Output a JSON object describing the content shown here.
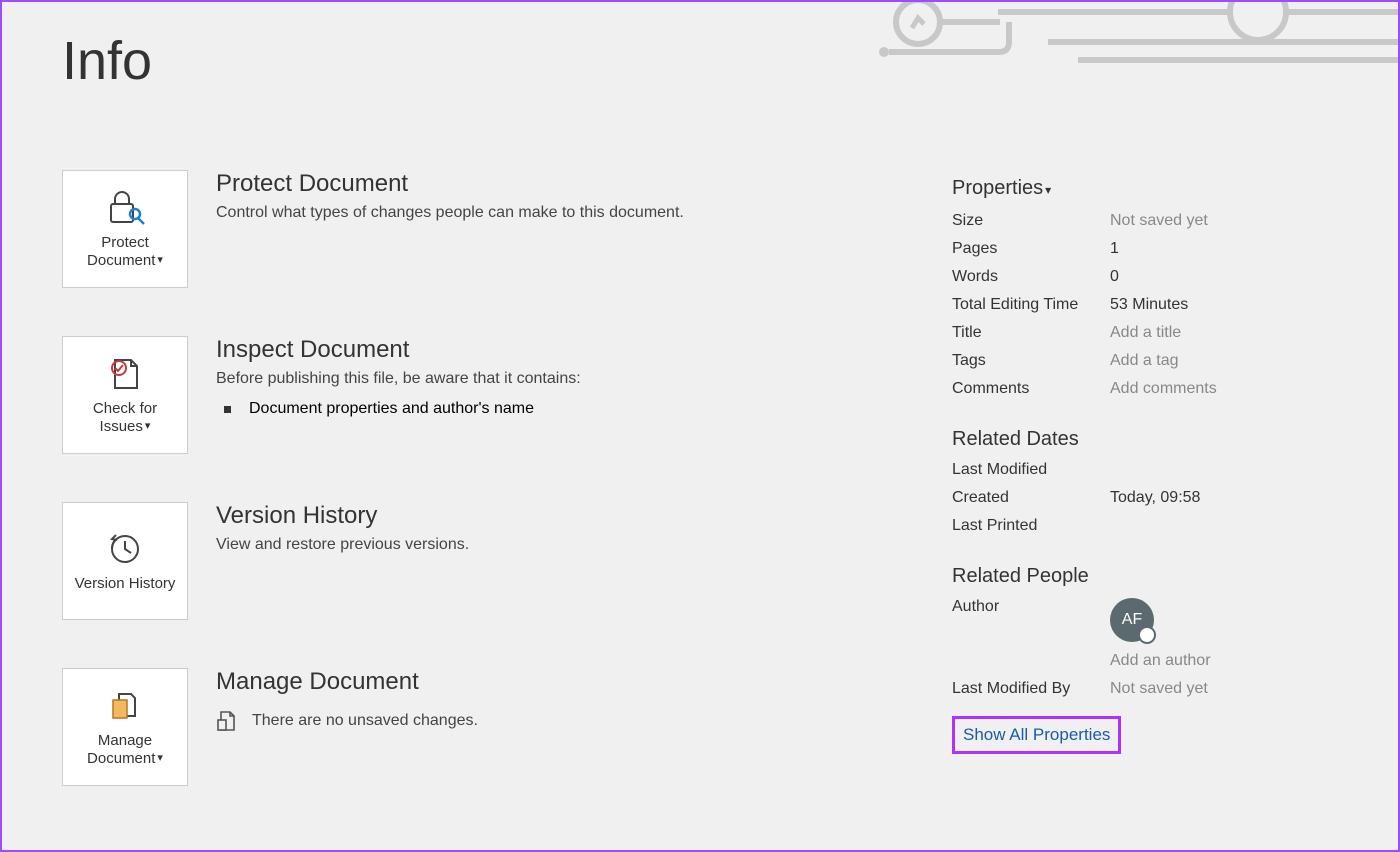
{
  "page_title": "Info",
  "sections": {
    "protect": {
      "tile_label": "Protect Document",
      "heading": "Protect Document",
      "desc": "Control what types of changes people can make to this document."
    },
    "inspect": {
      "tile_label": "Check for Issues",
      "heading": "Inspect Document",
      "desc": "Before publishing this file, be aware that it contains:",
      "bullet1": "Document properties and author's name"
    },
    "version": {
      "tile_label": "Version History",
      "heading": "Version History",
      "desc": "View and restore previous versions."
    },
    "manage": {
      "tile_label": "Manage Document",
      "heading": "Manage Document",
      "desc": "There are no unsaved changes."
    }
  },
  "properties": {
    "header": "Properties",
    "rows": {
      "size_label": "Size",
      "size_value": "Not saved yet",
      "pages_label": "Pages",
      "pages_value": "1",
      "words_label": "Words",
      "words_value": "0",
      "editing_label": "Total Editing Time",
      "editing_value": "53 Minutes",
      "title_label": "Title",
      "title_value": "Add a title",
      "tags_label": "Tags",
      "tags_value": "Add a tag",
      "comments_label": "Comments",
      "comments_value": "Add comments"
    }
  },
  "related_dates": {
    "header": "Related Dates",
    "last_modified_label": "Last Modified",
    "last_modified_value": "",
    "created_label": "Created",
    "created_value": "Today, 09:58",
    "last_printed_label": "Last Printed",
    "last_printed_value": ""
  },
  "related_people": {
    "header": "Related People",
    "author_label": "Author",
    "author_initials": "AF",
    "add_author": "Add an author",
    "last_modified_by_label": "Last Modified By",
    "last_modified_by_value": "Not saved yet"
  },
  "show_all_label": "Show All Properties"
}
